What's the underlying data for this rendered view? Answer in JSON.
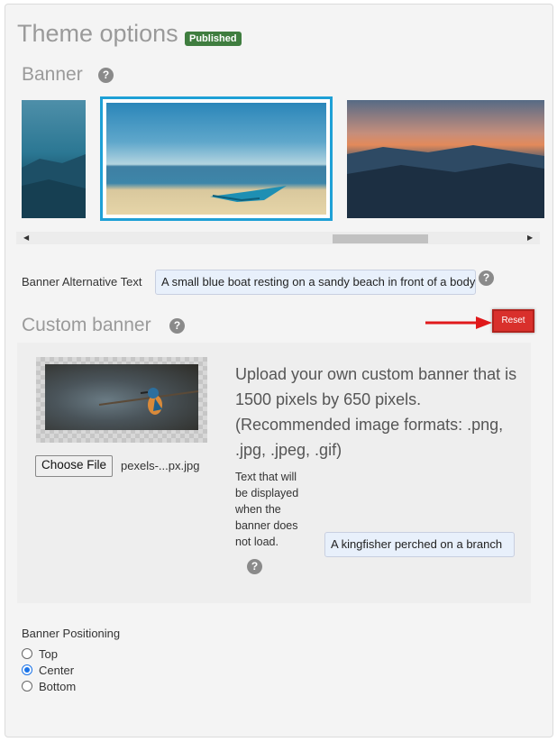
{
  "header": {
    "title": "Theme options",
    "badge": "Published"
  },
  "banner": {
    "heading": "Banner",
    "help_icon": "question-circle-icon",
    "alt_label": "Banner Alternative Text",
    "alt_value": "A small blue boat resting on a sandy beach in front of a body of water"
  },
  "custom_banner": {
    "heading": "Custom banner",
    "reset_label": "Reset",
    "upload_text": "Upload your own custom banner that is 1500 pixels by 650 pixels. (Recommended image formats: .png, .jpg, .jpeg, .gif)",
    "choose_label": "Choose File",
    "file_name": "pexels-...px.jpg",
    "alt_help_text": "Text that will be displayed when the banner does not load.",
    "alt_value": "A kingfisher perched on a branch"
  },
  "positioning": {
    "label": "Banner Positioning",
    "options": [
      "Top",
      "Center",
      "Bottom"
    ],
    "selected": "Center"
  },
  "colors": {
    "accent": "#1ea0d6",
    "badge": "#3f7d3f",
    "reset": "#d9302c",
    "arrow": "#e0191b"
  }
}
